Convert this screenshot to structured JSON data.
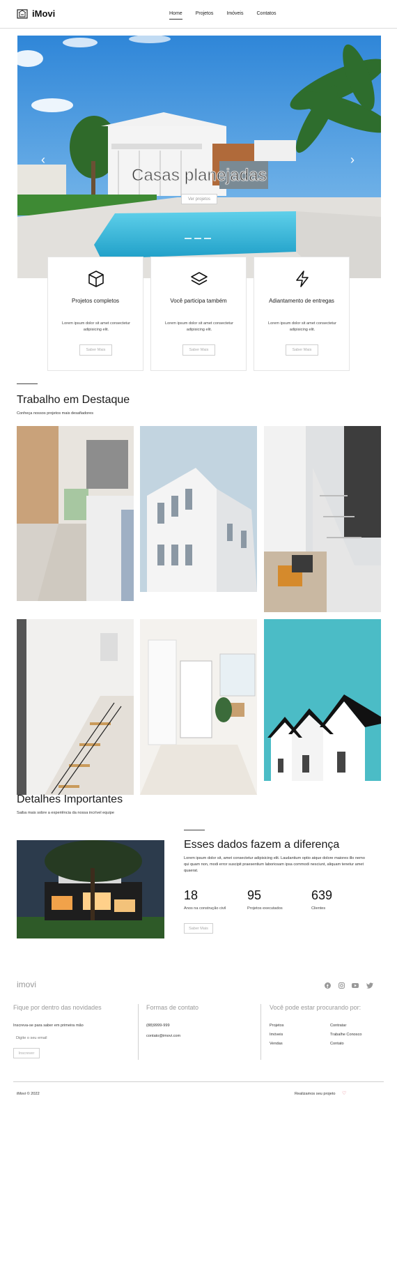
{
  "header": {
    "brand": "iMovi",
    "nav": [
      "Home",
      "Projetos",
      "Imóveis",
      "Contatos"
    ]
  },
  "hero": {
    "title": "Casas planejadas",
    "button": "Ver projetos",
    "prev": "‹",
    "next": "›"
  },
  "features": [
    {
      "title": "Projetos completos",
      "desc": "Lorem ipsum dolor sit amet consectetur adipisicing elit.",
      "button": "Saber Mais",
      "icon": "cube-icon"
    },
    {
      "title": "Você participa também",
      "desc": "Lorem ipsum dolor sit amet consectetur adipisicing elit.",
      "button": "Saber Mais",
      "icon": "layers-icon"
    },
    {
      "title": "Adiantamento de entregas",
      "desc": "Lorem ipsum dolor sit amet consectetur adipisicing elit.",
      "button": "Saber Mais",
      "icon": "lightning-icon"
    }
  ],
  "featured": {
    "title": "Trabalho em Destaque",
    "subtitle": "Conheça nossos projetos mais desafiadores"
  },
  "details": {
    "title": "Detalhes Importantes",
    "subtitle": "Saiba mais sobre a experiência da nossa incrível equipe"
  },
  "data_section": {
    "title": "Esses dados fazem a diferença",
    "text": "Lorem ipsum dolor sit, amet consectetur adipisicing elit. Laudantium optio atque dolore maiores illo nemo qui quam non, modi error suscipit praesentium laboriosam ipsa commodi nesciunt, aliquam tenetur amet quaerat.",
    "stats": [
      {
        "value": "18",
        "label": "Anos na construção civil"
      },
      {
        "value": "95",
        "label": "Projetos executados"
      },
      {
        "value": "639",
        "label": "Clientes"
      }
    ],
    "button": "Saber Mais"
  },
  "footer": {
    "brand": "imovi",
    "social_icons": [
      "facebook-icon",
      "instagram-icon",
      "youtube-icon",
      "twitter-icon"
    ],
    "newsletter": {
      "heading": "Fique por dentro das novidades",
      "text": "Inscreva-se para saber em primeira mão",
      "placeholder": "Digite o seu email",
      "button": "Inscrever"
    },
    "contact": {
      "heading": "Formas de contato",
      "phone": "(88)9999-999",
      "email": "contato@imovi.com"
    },
    "links": {
      "heading": "Você pode estar procurando por:",
      "col1": [
        "Projetos",
        "Imóveis",
        "Vendas"
      ],
      "col2": [
        "Contratar",
        "Trabalhe Conosco",
        "Contato"
      ]
    },
    "copyright": "iMovi © 2022",
    "tagline": "Realizamos seu projeto",
    "heart": "♡"
  },
  "colors": {
    "sky": "#3b8fd6",
    "pool": "#36b5d8",
    "teal_sky": "#4bbcc6",
    "heart": "#e05b6e"
  }
}
